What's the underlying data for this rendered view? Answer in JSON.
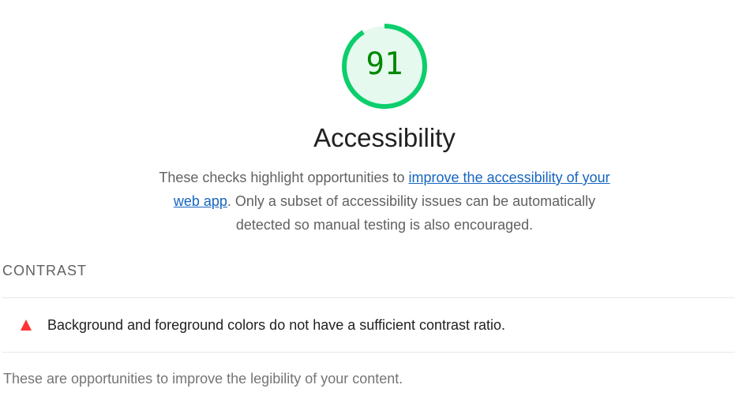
{
  "category": {
    "score": "91",
    "score_fraction": 0.91,
    "score_color": "#0cce6b",
    "score_text_color": "#008800",
    "score_bg_color": "#e5f9ef",
    "title": "Accessibility",
    "description_prefix": "These checks highlight opportunities to ",
    "description_link": "improve the accessibility of your web app",
    "description_suffix": ". Only a subset of accessibility issues can be automatically detected so manual testing is also encouraged."
  },
  "group": {
    "title": "CONTRAST",
    "audits": [
      {
        "status": "fail",
        "icon": "warning-triangle-icon",
        "status_color": "#ff3333",
        "text": "Background and foreground colors do not have a sufficient contrast ratio."
      }
    ],
    "description": "These are opportunities to improve the legibility of your content."
  }
}
